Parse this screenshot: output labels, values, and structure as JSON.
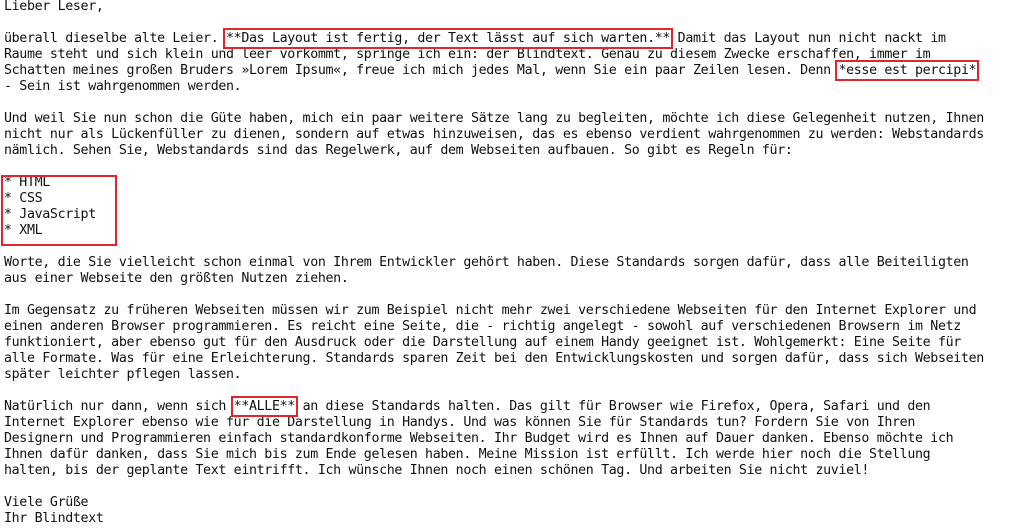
{
  "document": {
    "greeting": "Lieber Leser,",
    "p1": {
      "l1_pre": "überall dieselbe alte Leier. ",
      "l1_hl": "**Das Layout ist fertig, der Text lässt auf sich warten.**",
      "l1_post": " Damit das Layout nun nicht nackt im",
      "l2": "Raume steht und sich klein und leer vorkommt, springe ich ein: der Blindtext. Genau zu diesem Zwecke erschaffen, immer im",
      "l3_pre": "Schatten meines großen Bruders »Lorem Ipsum«, freue ich mich jedes Mal, wenn Sie ein paar Zeilen lesen. Denn ",
      "l3_hl": "*esse est percipi*",
      "l4": "- Sein ist wahrgenommen werden."
    },
    "p2": {
      "l1": "Und weil Sie nun schon die Güte haben, mich ein paar weitere Sätze lang zu begleiten, möchte ich diese Gelegenheit nutzen, Ihnen",
      "l2": "nicht nur als Lückenfüller zu dienen, sondern auf etwas hinzuweisen, das es ebenso verdient wahrgenommen zu werden: Webstandards",
      "l3": "nämlich. Sehen Sie, Webstandards sind das Regelwerk, auf dem Webseiten aufbauen. So gibt es Regeln für:"
    },
    "list": [
      "* HTML",
      "* CSS",
      "* JavaScript",
      "* XML"
    ],
    "p3": {
      "l1": "Worte, die Sie vielleicht schon einmal von Ihrem Entwickler gehört haben. Diese Standards sorgen dafür, dass alle Beiteiligten",
      "l2": "aus einer Webseite den größten Nutzen ziehen."
    },
    "p4": {
      "l1": "Im Gegensatz zu früheren Webseiten müssen wir zum Beispiel nicht mehr zwei verschiedene Webseiten für den Internet Explorer und",
      "l2": "einen anderen Browser programmieren. Es reicht eine Seite, die - richtig angelegt - sowohl auf verschiedenen Browsern im Netz",
      "l3": "funktioniert, aber ebenso gut für den Ausdruck oder die Darstellung auf einem Handy geeignet ist. Wohlgemerkt: Eine Seite für",
      "l4": "alle Formate. Was für eine Erleichterung. Standards sparen Zeit bei den Entwicklungskosten und sorgen dafür, dass sich Webseiten",
      "l5": "später leichter pflegen lassen."
    },
    "p5": {
      "l1_pre": "Natürlich nur dann, wenn sich ",
      "l1_hl": "**ALLE**",
      "l1_post": " an diese Standards halten. Das gilt für Browser wie Firefox, Opera, Safari und den",
      "l2": "Internet Explorer ebenso wie für die Darstellung in Handys. Und was können Sie für Standards tun? Fordern Sie von Ihren",
      "l3": "Designern und Programmieren einfach standardkonforme Webseiten. Ihr Budget wird es Ihnen auf Dauer danken. Ebenso möchte ich",
      "l4": "Ihnen dafür danken, dass Sie mich bis zum Ende gelesen haben. Meine Mission ist erfüllt. Ich werde hier noch die Stellung",
      "l5": "halten, bis der geplante Text eintrifft. Ich wünsche Ihnen noch einen schönen Tag. Und arbeiten Sie nicht zuviel!"
    },
    "closing": "Viele Grüße",
    "signature": "Ihr Blindtext"
  }
}
